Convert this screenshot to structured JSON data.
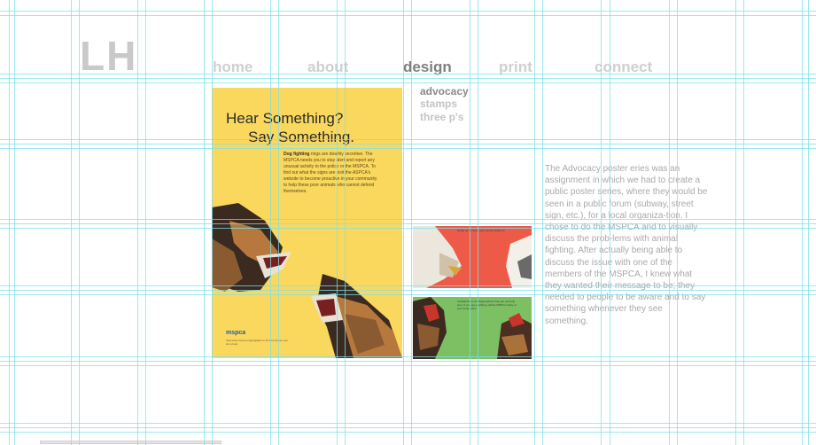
{
  "logo": "LH",
  "nav": {
    "home": "home",
    "about": "about",
    "design": "design",
    "print": "print",
    "connect": "connect"
  },
  "subnav": {
    "advocacy": "advocacy",
    "stamps": "stamps",
    "threeps": "three p's"
  },
  "poster": {
    "headline_1": "Hear Something?",
    "headline_2": "Say Something.",
    "body_lead": "Dog fighting",
    "body_text": " rings are deathly secretive. The MSPCA needs you to stay alert and report any unusual activity to the police or the MSPCA. To find out what the signs are visit the ASPCA's website to become proactive in your community to help these poor animals who cannot defend themselves.",
    "brand": "mspca",
    "brand_url": "Visit www.mspca.org/dogfights to find out all you can do to help"
  },
  "thumbs": {
    "red_caption": "speak up for those who cannot speak up",
    "green_caption": "cockfighting is an illegal activity that you can help stop. If you see anything, call the MSPCA today or your local police."
  },
  "description": "The Advocacy poster eries was an assignment in which we had to create a public poster series, where they would be seen in a public forum (subway, street sign, etc.), for a local organiza-tion. I chose to do the MSPCA and to visually discuss the prob-lems with animal fighting. After actually being able to discuss the issue with one of the members of the MSPCA, I knew what they wanted their message to be; they needed to people to be aware and to say something whenever they see something.",
  "colors": {
    "poster_bg": "#fad85e",
    "thumb_red": "#ee5a48",
    "thumb_green": "#7cc063",
    "grid": "#7ee0ea",
    "nav_active": "#808080",
    "nav_inactive": "#cfcfcf"
  }
}
